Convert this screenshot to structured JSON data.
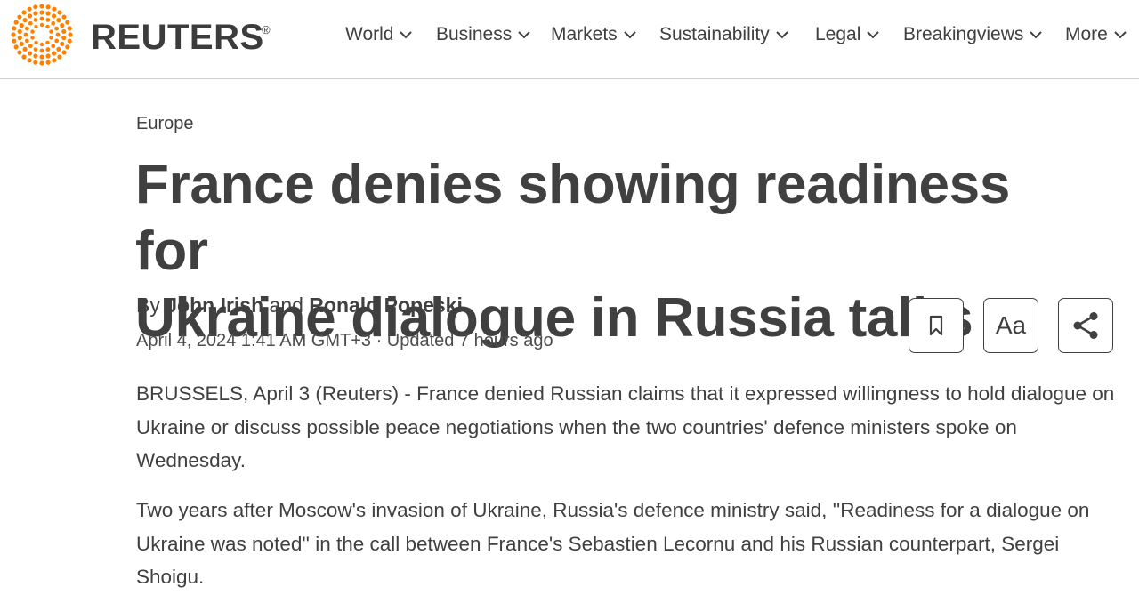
{
  "brand": {
    "name": "REUTERS",
    "registered": "®",
    "accent_color": "#ff8000"
  },
  "nav": {
    "items": [
      {
        "label": "World",
        "icon": "chevron-down-icon"
      },
      {
        "label": "Business",
        "icon": "chevron-down-icon"
      },
      {
        "label": "Markets",
        "icon": "chevron-down-icon"
      },
      {
        "label": "Sustainability",
        "icon": "chevron-down-icon"
      },
      {
        "label": "Legal",
        "icon": "chevron-down-icon"
      },
      {
        "label": "Breakingviews",
        "icon": "chevron-down-icon"
      },
      {
        "label": "More",
        "icon": "chevron-down-icon"
      }
    ]
  },
  "article": {
    "section": "Europe",
    "headline_line1": "France denies showing readiness for",
    "headline_line2": "Ukraine dialogue in Russia talks",
    "byline": {
      "prefix": "By",
      "author1": "John Irish",
      "conjunction": "and",
      "author2": "Ronald Popeski"
    },
    "dateline": "April 4, 2024 1:41 AM GMT+3 · Updated 7 hours ago",
    "paragraphs": [
      "BRUSSELS, April 3 (Reuters) - France denied Russian claims that it expressed willingness to hold dialogue on Ukraine or discuss possible peace negotiations when the two countries' defence ministers spoke on Wednesday.",
      "Two years after Moscow's invasion of Ukraine, Russia's defence ministry said, ''Readiness for a dialogue on Ukraine was noted'' in the call between France's Sebastien Lecornu and his Russian counterpart, Sergei Shoigu."
    ]
  },
  "tools": {
    "bookmark_icon": "bookmark-icon",
    "font_size_label": "Aa",
    "share_icon": "share-icon"
  }
}
